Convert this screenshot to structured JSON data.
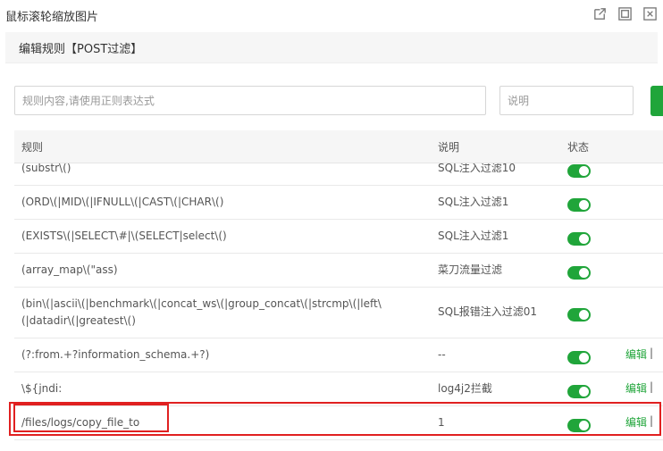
{
  "window": {
    "title": "鼠标滚轮缩放图片",
    "icons": [
      "external-link-icon",
      "maximize-icon",
      "close-icon"
    ]
  },
  "section": {
    "title": "编辑规则【POST过滤】"
  },
  "form": {
    "rule_placeholder": "规则内容,请使用正则表达式",
    "rule_value": "",
    "desc_placeholder": "说明",
    "desc_value": ""
  },
  "table": {
    "headers": {
      "rule": "规则",
      "desc": "说明",
      "status": "状态"
    },
    "rows": [
      {
        "rule": "(substr\\()",
        "desc": "SQL注入过滤10",
        "enabled": true,
        "edit": "",
        "sep": ""
      },
      {
        "rule": "(ORD\\(|MID\\(|IFNULL\\(|CAST\\(|CHAR\\()",
        "desc": "SQL注入过滤1",
        "enabled": true,
        "edit": "",
        "sep": ""
      },
      {
        "rule": "(EXISTS\\(|SELECT\\#|\\(SELECT|select\\()",
        "desc": "SQL注入过滤1",
        "enabled": true,
        "edit": "",
        "sep": ""
      },
      {
        "rule": "(array_map\\(\"ass)",
        "desc": "菜刀流量过滤",
        "enabled": true,
        "edit": "",
        "sep": ""
      },
      {
        "rule": "(bin\\(|ascii\\(|benchmark\\(|concat_ws\\(|group_concat\\(|strcmp\\(|left\\(|datadir\\(|greatest\\()",
        "desc": "SQL报错注入过滤01",
        "enabled": true,
        "edit": "",
        "sep": ""
      },
      {
        "rule": "(?:from.+?information_schema.+?)",
        "desc": "--",
        "enabled": true,
        "edit": "编辑",
        "sep": "|"
      },
      {
        "rule": "\\${jndi:",
        "desc": "log4j2拦截",
        "enabled": true,
        "edit": "编辑",
        "sep": "|"
      },
      {
        "rule": "/files/logs/copy_file_to",
        "desc": "1",
        "enabled": true,
        "edit": "编辑",
        "sep": "|"
      }
    ]
  },
  "colors": {
    "accent": "#20a53a",
    "highlight": "#e02020"
  }
}
